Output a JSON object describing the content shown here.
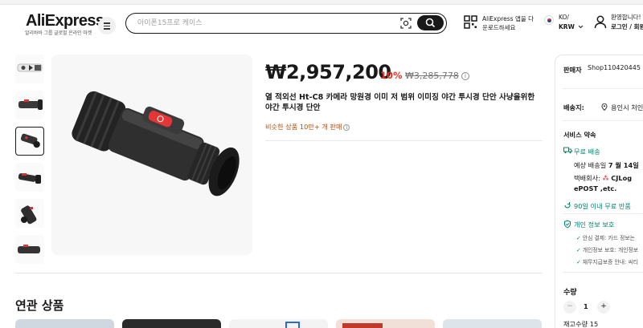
{
  "header": {
    "logo": "AliExpress",
    "logo_sub": "알리바바 그룹 글로벌 온라인 마켓",
    "search_placeholder": "아이폰15프로 케이스",
    "app_line1": "AliExpress 앱을 다",
    "app_line2": "운로드하세요",
    "lang_line1": "KO/",
    "lang_line2": "KRW",
    "user_line1": "환영합니다!",
    "user_line2": "로그인 / 회원"
  },
  "product": {
    "price": "₩2,957,200",
    "discount": "10%",
    "original_price": "₩3,285,778",
    "title": "열 적외선 Ht-C8 카메라 망원경 이미 저 범위 이미징 야간 투시경 단안 사냥을위한 야간 투시경 단안",
    "sold": "비슷한 상품 10만+ 개 판매"
  },
  "thumbnails": [
    "thumb-1",
    "thumb-2",
    "thumb-3",
    "thumb-4",
    "thumb-5",
    "thumb-6"
  ],
  "related": {
    "title": "연관 상품"
  },
  "panel": {
    "seller_label": "판매자",
    "seller_name": "Shop110420445",
    "shipping_label": "배송지:",
    "shipping_location": "용인시 처인",
    "service_title": "서비스 약속",
    "free_shipping": "무료 배송",
    "delivery_label": "예상 배송일",
    "delivery_date": "7 월 14일",
    "courier_label": "택배회사:",
    "courier_name": "CJLog",
    "courier_more": "ePOST ,etc.",
    "free_return": "90일 이내 무료 반품",
    "privacy_title": "개인 정보 보호",
    "privacy_1": "안심 결제: 카드 정보는",
    "privacy_2": "개인정보 보호: 개인정보",
    "privacy_3": "채무지급보증 안내: 씨티",
    "quantity_label": "수량",
    "quantity_value": "1",
    "minus": "−",
    "plus": "+",
    "stock": "재고수량 15"
  },
  "colors": {
    "price_red": "#e43225",
    "sold_orange": "#b04b0e",
    "service_green": "#00856f"
  }
}
